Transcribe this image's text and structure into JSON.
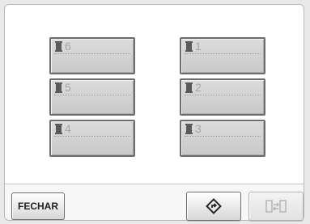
{
  "slots_left": [
    {
      "number": "6"
    },
    {
      "number": "5"
    },
    {
      "number": "4"
    }
  ],
  "slots_right": [
    {
      "number": "1"
    },
    {
      "number": "2"
    },
    {
      "number": "3"
    }
  ],
  "buttons": {
    "close_label": "FECHAR",
    "reset_icon": "diamond-rotate-icon",
    "swap_icon": "spool-swap-icon"
  }
}
